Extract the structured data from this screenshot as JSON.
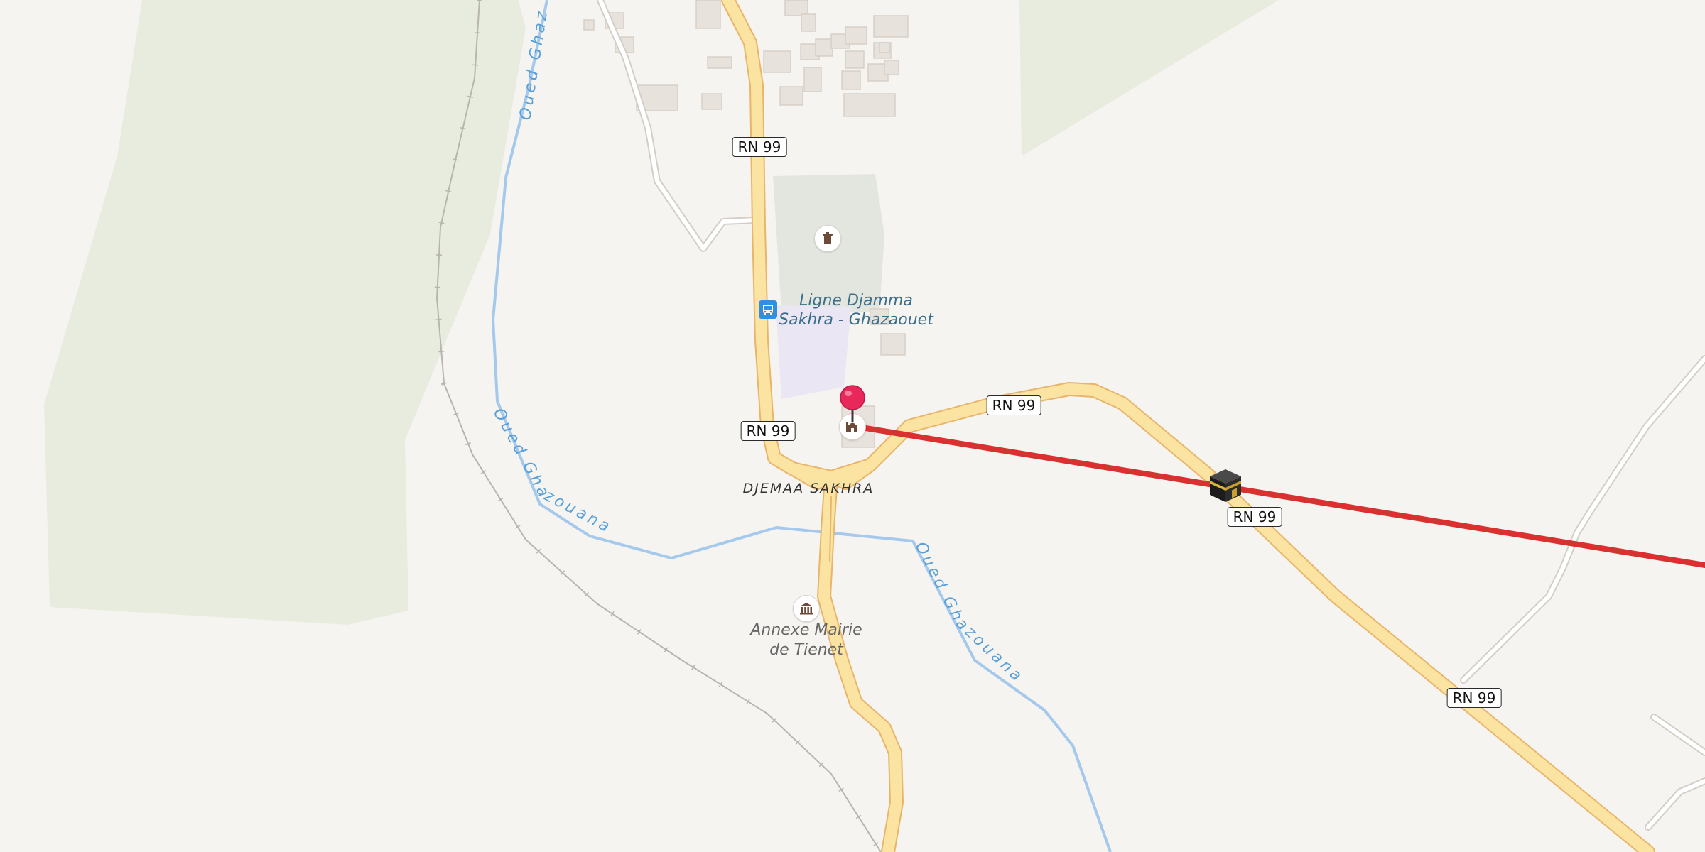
{
  "map": {
    "road_name": "RN 99",
    "road_shields": [
      "RN 99",
      "RN 99",
      "RN 99",
      "RN 99",
      "RN 99"
    ],
    "river_name": "Oued Ghazouana",
    "river_labels": [
      "Oued Ghaz",
      "Oued Ghazouana",
      "Oued Ghazouana"
    ],
    "settlement": "DJEMAA SAKHRA",
    "transit_label_line1": "Ligne Djamma",
    "transit_label_line2": "Sakhra - Ghazaouet",
    "townhall_line1": "Annexe Mairie",
    "townhall_line2": "de Tienet",
    "icons": {
      "cemetery": "cemetery-icon",
      "bus": "bus-stop-icon",
      "mosque": "mosque-icon",
      "townhall": "townhall-icon",
      "pin": "location-pin-icon",
      "qibla": "kaaba-icon"
    },
    "colors": {
      "background": "#f6f4f0",
      "woodland": "#e8ecdf",
      "road_fill": "#fbe3a2",
      "road_casing": "#e8b56a",
      "river": "#a5c9ec",
      "qibla_line": "#d93030",
      "pin": "#e8285a"
    }
  }
}
